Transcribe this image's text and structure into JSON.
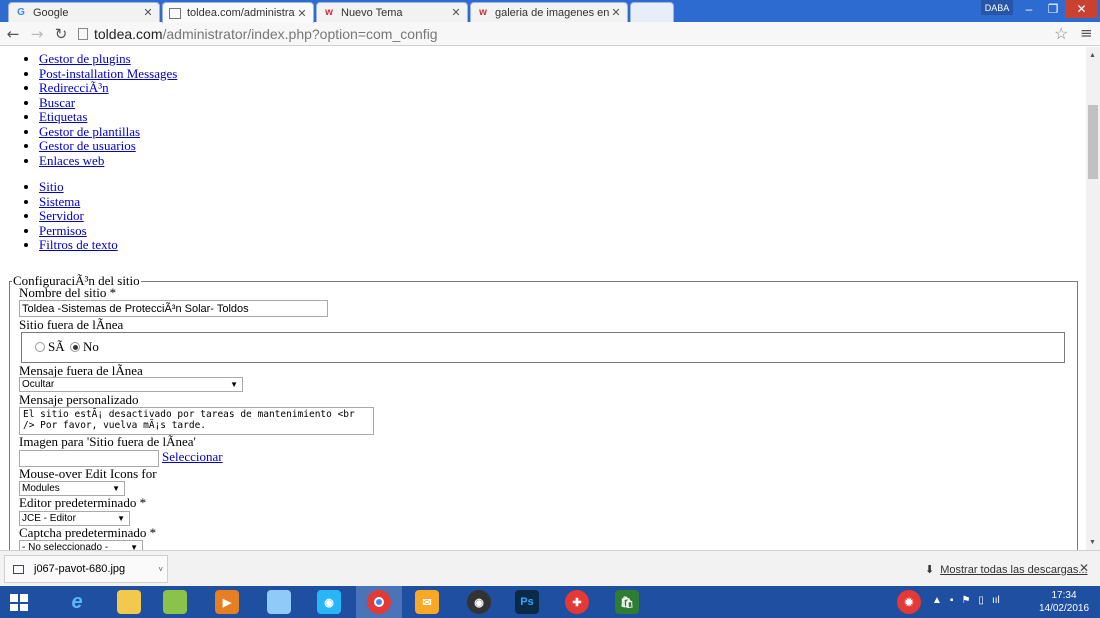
{
  "browser": {
    "tabs": [
      {
        "label": "Google",
        "icon": "google-icon",
        "active": false
      },
      {
        "label": "toldea.com/administrator/",
        "icon": "page-icon",
        "active": true
      },
      {
        "label": "Nuevo Tema",
        "icon": "w-icon",
        "active": false
      },
      {
        "label": "galeria de imagenes en pl",
        "icon": "w-icon",
        "active": false
      }
    ],
    "user_badge": "DABA",
    "url_host": "toldea.com",
    "url_rest": "/administrator/index.php?option=com_config"
  },
  "menu_links_1": [
    "Gestor de plugins",
    "Post-installation Messages",
    "RedirecciÃ³n",
    "Buscar",
    "Etiquetas",
    "Gestor de plantillas",
    "Gestor de usuarios",
    "Enlaces web"
  ],
  "menu_links_2": [
    "Sitio",
    "Sistema",
    "Servidor",
    "Permisos",
    "Filtros de texto"
  ],
  "config": {
    "legend": "ConfiguraciÃ³n del sitio",
    "site_name_label": "Nombre del sitio *",
    "site_name_value": "Toldea  -Sistemas de ProtecciÃ³n Solar-  Toldos",
    "offline_label": "Sitio fuera de lÃ­nea",
    "offline_yes": "SÃ­",
    "offline_no": "No",
    "offline_message_label": "Mensaje fuera de lÃ­nea",
    "offline_message_value": "Ocultar",
    "custom_message_label": "Mensaje personalizado",
    "custom_message_value": "El sitio estÃ¡ desactivado por tareas de mantenimiento <br\n/> Por favor, vuelva mÃ¡s tarde.",
    "offline_image_label": "Imagen para 'Sitio fuera de lÃ­nea'",
    "select_button": "Seleccionar",
    "edit_icons_label": "Mouse-over Edit Icons for",
    "edit_icons_value": "Modules",
    "editor_label": "Editor predeterminado *",
    "editor_value": "JCE - Editor",
    "captcha_label": "Captcha predeterminado *",
    "captcha_value": "- No seleccionado -"
  },
  "downloads": {
    "file_name": "j067-pavot-680.jpg",
    "show_all": "Mostrar todas las descargas..."
  },
  "taskbar": {
    "time": "17:34",
    "date": "14/02/2016"
  }
}
